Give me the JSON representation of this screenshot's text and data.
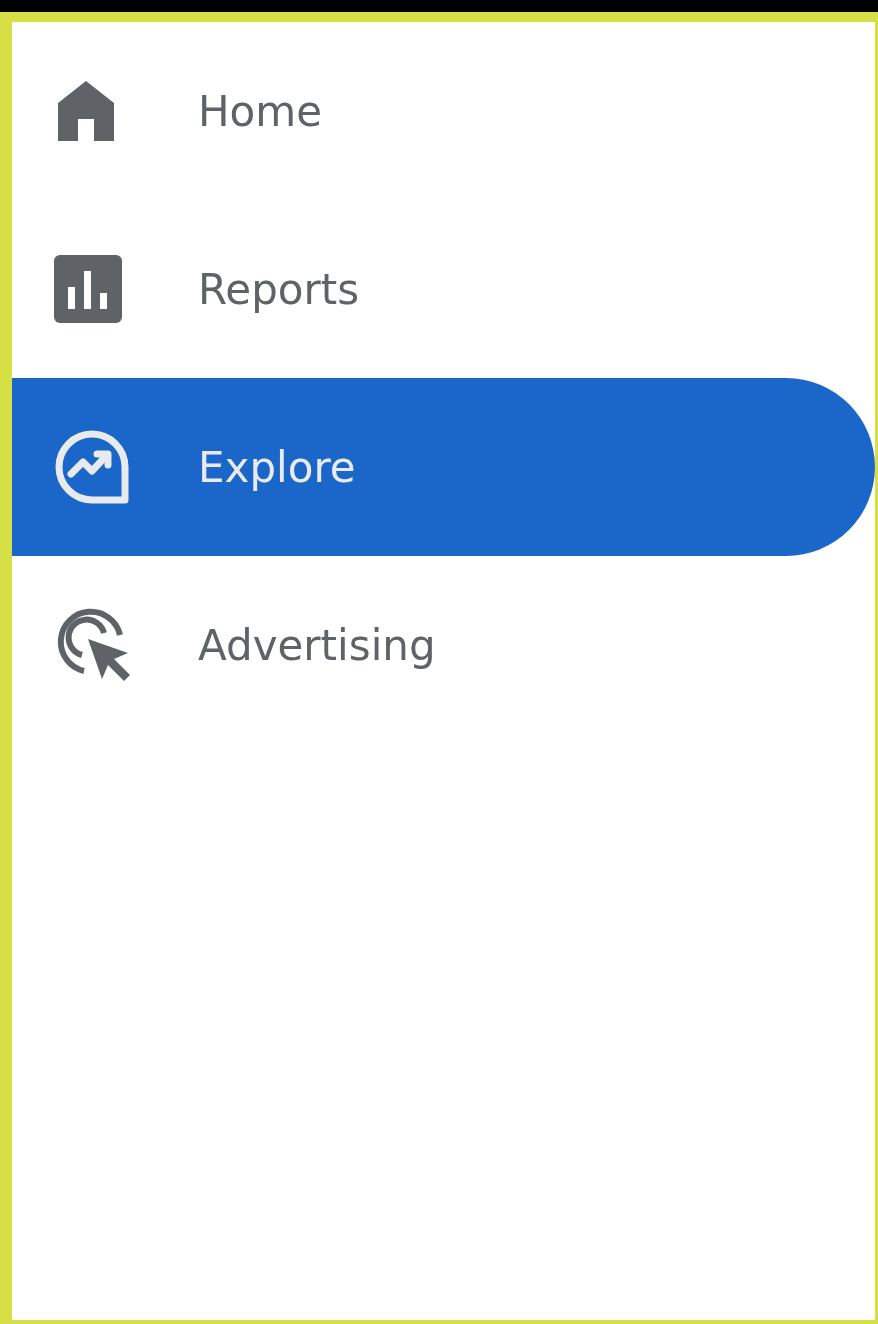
{
  "nav": [
    {
      "label": "Home",
      "kind": "home",
      "selected": false
    },
    {
      "label": "Reports",
      "kind": "reports",
      "selected": false
    },
    {
      "label": "Explore",
      "kind": "explore",
      "selected": true
    },
    {
      "label": "Advertising",
      "kind": "advertising",
      "selected": false
    }
  ]
}
